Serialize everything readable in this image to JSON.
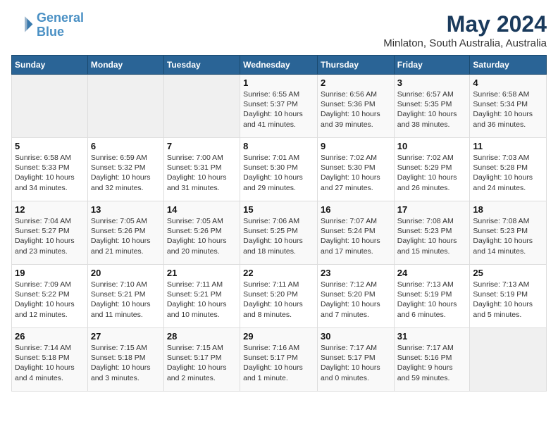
{
  "logo": {
    "line1": "General",
    "line2": "Blue"
  },
  "title": "May 2024",
  "subtitle": "Minlaton, South Australia, Australia",
  "weekdays": [
    "Sunday",
    "Monday",
    "Tuesday",
    "Wednesday",
    "Thursday",
    "Friday",
    "Saturday"
  ],
  "weeks": [
    [
      {
        "day": "",
        "info": ""
      },
      {
        "day": "",
        "info": ""
      },
      {
        "day": "",
        "info": ""
      },
      {
        "day": "1",
        "info": "Sunrise: 6:55 AM\nSunset: 5:37 PM\nDaylight: 10 hours\nand 41 minutes."
      },
      {
        "day": "2",
        "info": "Sunrise: 6:56 AM\nSunset: 5:36 PM\nDaylight: 10 hours\nand 39 minutes."
      },
      {
        "day": "3",
        "info": "Sunrise: 6:57 AM\nSunset: 5:35 PM\nDaylight: 10 hours\nand 38 minutes."
      },
      {
        "day": "4",
        "info": "Sunrise: 6:58 AM\nSunset: 5:34 PM\nDaylight: 10 hours\nand 36 minutes."
      }
    ],
    [
      {
        "day": "5",
        "info": "Sunrise: 6:58 AM\nSunset: 5:33 PM\nDaylight: 10 hours\nand 34 minutes."
      },
      {
        "day": "6",
        "info": "Sunrise: 6:59 AM\nSunset: 5:32 PM\nDaylight: 10 hours\nand 32 minutes."
      },
      {
        "day": "7",
        "info": "Sunrise: 7:00 AM\nSunset: 5:31 PM\nDaylight: 10 hours\nand 31 minutes."
      },
      {
        "day": "8",
        "info": "Sunrise: 7:01 AM\nSunset: 5:30 PM\nDaylight: 10 hours\nand 29 minutes."
      },
      {
        "day": "9",
        "info": "Sunrise: 7:02 AM\nSunset: 5:30 PM\nDaylight: 10 hours\nand 27 minutes."
      },
      {
        "day": "10",
        "info": "Sunrise: 7:02 AM\nSunset: 5:29 PM\nDaylight: 10 hours\nand 26 minutes."
      },
      {
        "day": "11",
        "info": "Sunrise: 7:03 AM\nSunset: 5:28 PM\nDaylight: 10 hours\nand 24 minutes."
      }
    ],
    [
      {
        "day": "12",
        "info": "Sunrise: 7:04 AM\nSunset: 5:27 PM\nDaylight: 10 hours\nand 23 minutes."
      },
      {
        "day": "13",
        "info": "Sunrise: 7:05 AM\nSunset: 5:26 PM\nDaylight: 10 hours\nand 21 minutes."
      },
      {
        "day": "14",
        "info": "Sunrise: 7:05 AM\nSunset: 5:26 PM\nDaylight: 10 hours\nand 20 minutes."
      },
      {
        "day": "15",
        "info": "Sunrise: 7:06 AM\nSunset: 5:25 PM\nDaylight: 10 hours\nand 18 minutes."
      },
      {
        "day": "16",
        "info": "Sunrise: 7:07 AM\nSunset: 5:24 PM\nDaylight: 10 hours\nand 17 minutes."
      },
      {
        "day": "17",
        "info": "Sunrise: 7:08 AM\nSunset: 5:23 PM\nDaylight: 10 hours\nand 15 minutes."
      },
      {
        "day": "18",
        "info": "Sunrise: 7:08 AM\nSunset: 5:23 PM\nDaylight: 10 hours\nand 14 minutes."
      }
    ],
    [
      {
        "day": "19",
        "info": "Sunrise: 7:09 AM\nSunset: 5:22 PM\nDaylight: 10 hours\nand 12 minutes."
      },
      {
        "day": "20",
        "info": "Sunrise: 7:10 AM\nSunset: 5:21 PM\nDaylight: 10 hours\nand 11 minutes."
      },
      {
        "day": "21",
        "info": "Sunrise: 7:11 AM\nSunset: 5:21 PM\nDaylight: 10 hours\nand 10 minutes."
      },
      {
        "day": "22",
        "info": "Sunrise: 7:11 AM\nSunset: 5:20 PM\nDaylight: 10 hours\nand 8 minutes."
      },
      {
        "day": "23",
        "info": "Sunrise: 7:12 AM\nSunset: 5:20 PM\nDaylight: 10 hours\nand 7 minutes."
      },
      {
        "day": "24",
        "info": "Sunrise: 7:13 AM\nSunset: 5:19 PM\nDaylight: 10 hours\nand 6 minutes."
      },
      {
        "day": "25",
        "info": "Sunrise: 7:13 AM\nSunset: 5:19 PM\nDaylight: 10 hours\nand 5 minutes."
      }
    ],
    [
      {
        "day": "26",
        "info": "Sunrise: 7:14 AM\nSunset: 5:18 PM\nDaylight: 10 hours\nand 4 minutes."
      },
      {
        "day": "27",
        "info": "Sunrise: 7:15 AM\nSunset: 5:18 PM\nDaylight: 10 hours\nand 3 minutes."
      },
      {
        "day": "28",
        "info": "Sunrise: 7:15 AM\nSunset: 5:17 PM\nDaylight: 10 hours\nand 2 minutes."
      },
      {
        "day": "29",
        "info": "Sunrise: 7:16 AM\nSunset: 5:17 PM\nDaylight: 10 hours\nand 1 minute."
      },
      {
        "day": "30",
        "info": "Sunrise: 7:17 AM\nSunset: 5:17 PM\nDaylight: 10 hours\nand 0 minutes."
      },
      {
        "day": "31",
        "info": "Sunrise: 7:17 AM\nSunset: 5:16 PM\nDaylight: 9 hours\nand 59 minutes."
      },
      {
        "day": "",
        "info": ""
      }
    ]
  ]
}
